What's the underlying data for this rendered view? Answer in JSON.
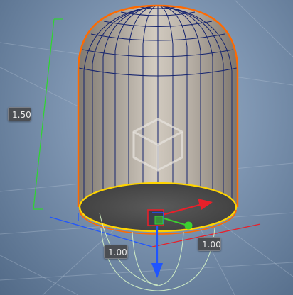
{
  "viewport": {
    "background_color": "#6f87a4",
    "object": {
      "shape": "capsule",
      "fill_color": "#b8b0a6",
      "outline_color": "#ff6a00",
      "wire_color": "#15246e",
      "selected_edge_color": "#ffd400"
    },
    "dimensions": {
      "height_label": "1.50",
      "width_label": "1.00",
      "depth_label": "1.00"
    },
    "axes": {
      "x_color": "#e8202a",
      "y_color": "#2ed62e",
      "z_color": "#1f55ff"
    },
    "gizmo": {
      "move_arrow_x_color": "#e8202a",
      "move_arrow_down_color": "#1f55ff",
      "scale_handle_color": "#3bd12f",
      "center_cube_icon": "cube-icon"
    }
  }
}
